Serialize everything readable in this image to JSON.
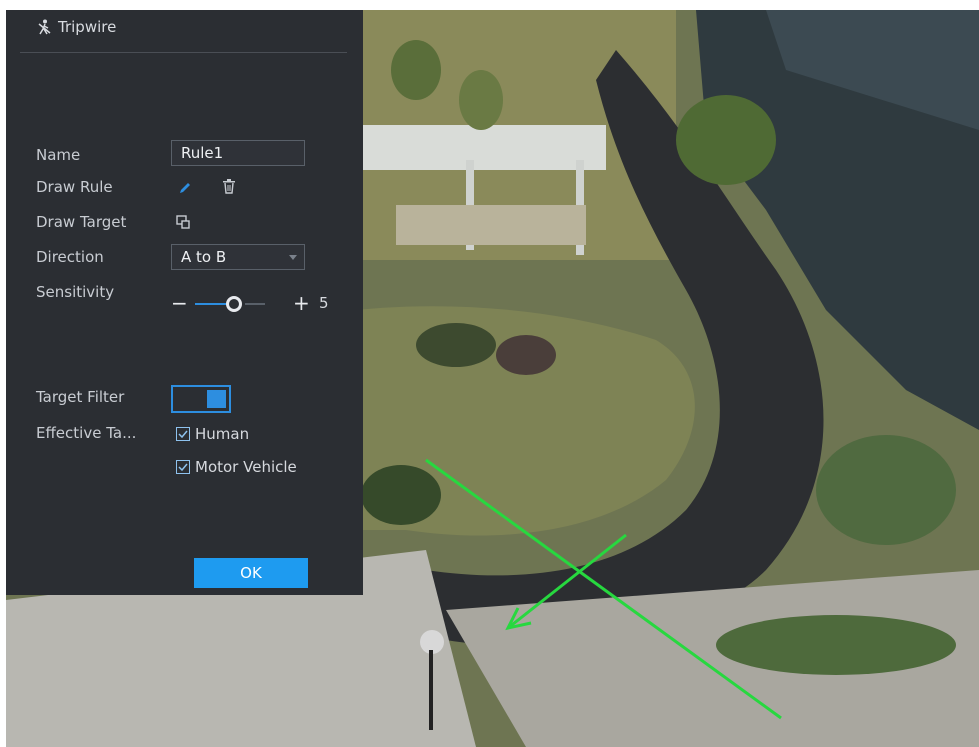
{
  "panel": {
    "title": "Tripwire",
    "title_icon": "tripwire-person-icon",
    "name_label": "Name",
    "name_value": "Rule1",
    "draw_rule_label": "Draw Rule",
    "draw_rule_icons": [
      "pencil-icon",
      "trash-icon"
    ],
    "draw_target_label": "Draw Target",
    "draw_target_icon": "draw-target-icon",
    "direction_label": "Direction",
    "direction_value": "A to B",
    "sensitivity_label": "Sensitivity",
    "sensitivity_minus": "−",
    "sensitivity_plus": "+",
    "sensitivity_value": "5",
    "target_filter_label": "Target Filter",
    "target_filter_on": true,
    "effective_target_label": "Effective Ta...",
    "targets": [
      {
        "label": "Human",
        "checked": true
      },
      {
        "label": "Motor Vehicle",
        "checked": true
      }
    ],
    "ok_label": "OK"
  },
  "colors": {
    "accent": "#2d8ee0",
    "ok_button": "#1e9bf0",
    "panel_bg": "#2b2e33",
    "tripwire_line": "#27d83f"
  }
}
